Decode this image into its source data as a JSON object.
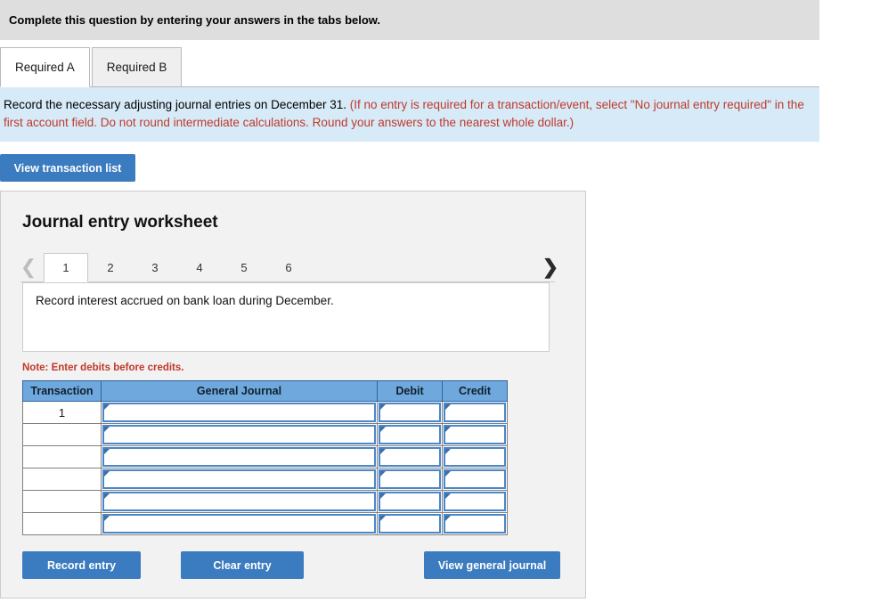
{
  "header": {
    "instruction": "Complete this question by entering your answers in the tabs below."
  },
  "tabs": [
    {
      "label": "Required A",
      "active": true
    },
    {
      "label": "Required B",
      "active": false
    }
  ],
  "instruction_panel": {
    "black_text": "Record the necessary adjusting journal entries on December 31.",
    "red_text": "(If no entry is required for a transaction/event, select \"No journal entry required\" in the first account field. Do not round intermediate calculations. Round your answers to the nearest whole dollar.)"
  },
  "toolbar": {
    "view_transaction_list_label": "View transaction list"
  },
  "worksheet": {
    "title": "Journal entry worksheet",
    "pager": {
      "prev_icon": "chevron-left-icon",
      "next_icon": "chevron-right-icon",
      "pages": [
        "1",
        "2",
        "3",
        "4",
        "5",
        "6"
      ],
      "active_page": "1"
    },
    "description": "Record interest accrued on bank loan during December.",
    "note": "Note: Enter debits before credits.",
    "table": {
      "columns": [
        "Transaction",
        "General Journal",
        "Debit",
        "Credit"
      ],
      "rows": [
        {
          "transaction": "1",
          "general_journal": "",
          "debit": "",
          "credit": ""
        },
        {
          "transaction": "",
          "general_journal": "",
          "debit": "",
          "credit": ""
        },
        {
          "transaction": "",
          "general_journal": "",
          "debit": "",
          "credit": ""
        },
        {
          "transaction": "",
          "general_journal": "",
          "debit": "",
          "credit": ""
        },
        {
          "transaction": "",
          "general_journal": "",
          "debit": "",
          "credit": ""
        },
        {
          "transaction": "",
          "general_journal": "",
          "debit": "",
          "credit": ""
        }
      ]
    },
    "buttons": {
      "record_entry": "Record entry",
      "clear_entry": "Clear entry",
      "view_general_journal": "View general journal"
    }
  },
  "colors": {
    "button_blue": "#3b7bbf",
    "table_header_blue": "#6fa8dc",
    "instruction_panel_blue": "#d6eaf8",
    "header_gray": "#dedede",
    "red_text": "#c0392b"
  }
}
